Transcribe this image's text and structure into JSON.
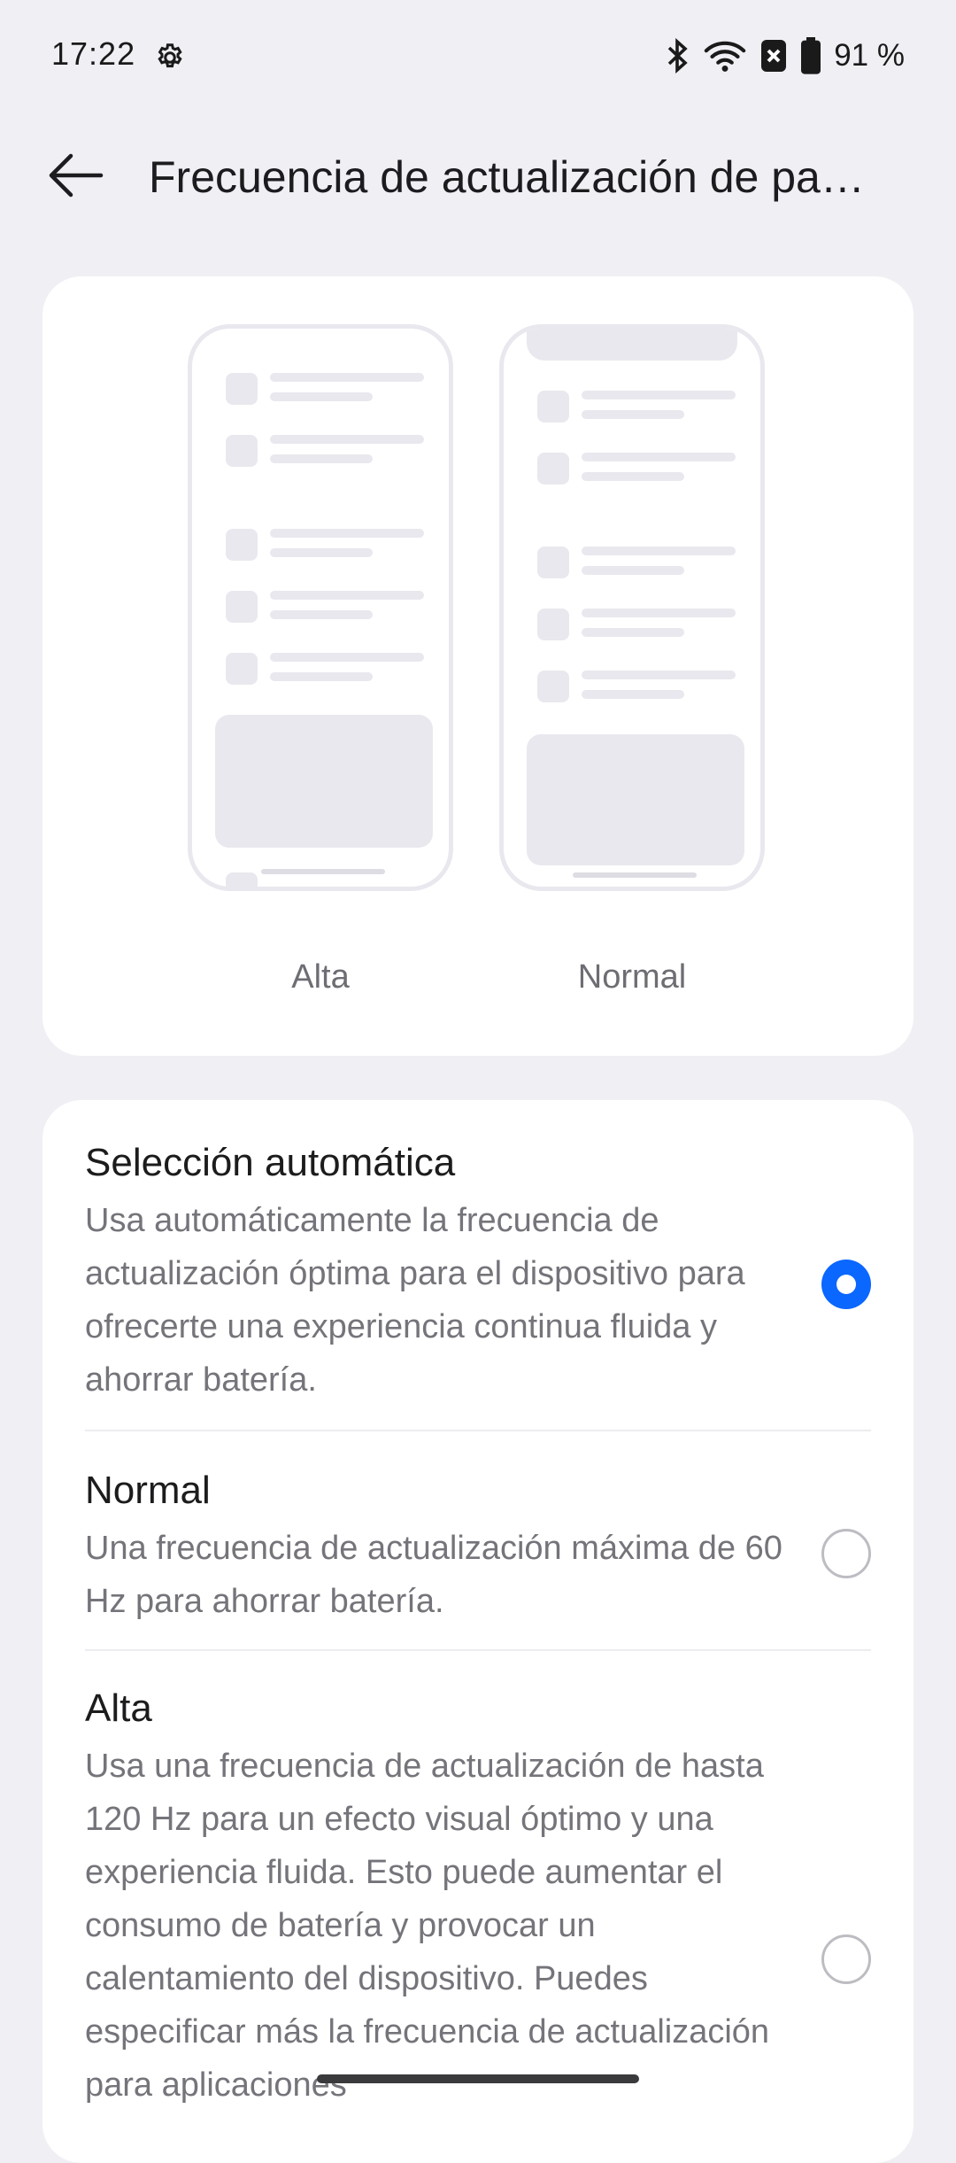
{
  "status_bar": {
    "time": "17:22",
    "battery": "91 %",
    "icons": [
      "settings-gear-icon",
      "bluetooth-icon",
      "wifi-icon",
      "sim-x-icon",
      "battery-icon"
    ]
  },
  "header": {
    "title": "Frecuencia de actualización de pa…",
    "back_icon": "arrow-left-icon"
  },
  "preview": {
    "labels": [
      "Alta",
      "Normal"
    ]
  },
  "options": [
    {
      "title": "Selección automática",
      "description": "Usa automáticamente la frecuencia de actualización óptima para el dispositivo para ofrecerte una experiencia continua fluida y ahorrar batería.",
      "selected": true
    },
    {
      "title": "Normal",
      "description": "Una frecuencia de actualización máxima de 60 Hz para ahorrar batería.",
      "selected": false
    },
    {
      "title": "Alta",
      "description": "Usa una frecuencia de actualización de hasta 120 Hz para un efecto visual óptimo y una experiencia fluida. Esto puede aumentar el consumo de batería y provocar un calentamiento del dispositivo. Puedes especificar más la frecuencia de actualización para aplicaciones",
      "selected": false
    }
  ],
  "colors": {
    "accent": "#0a67ff",
    "background": "#f0eff4",
    "card": "#ffffff"
  }
}
